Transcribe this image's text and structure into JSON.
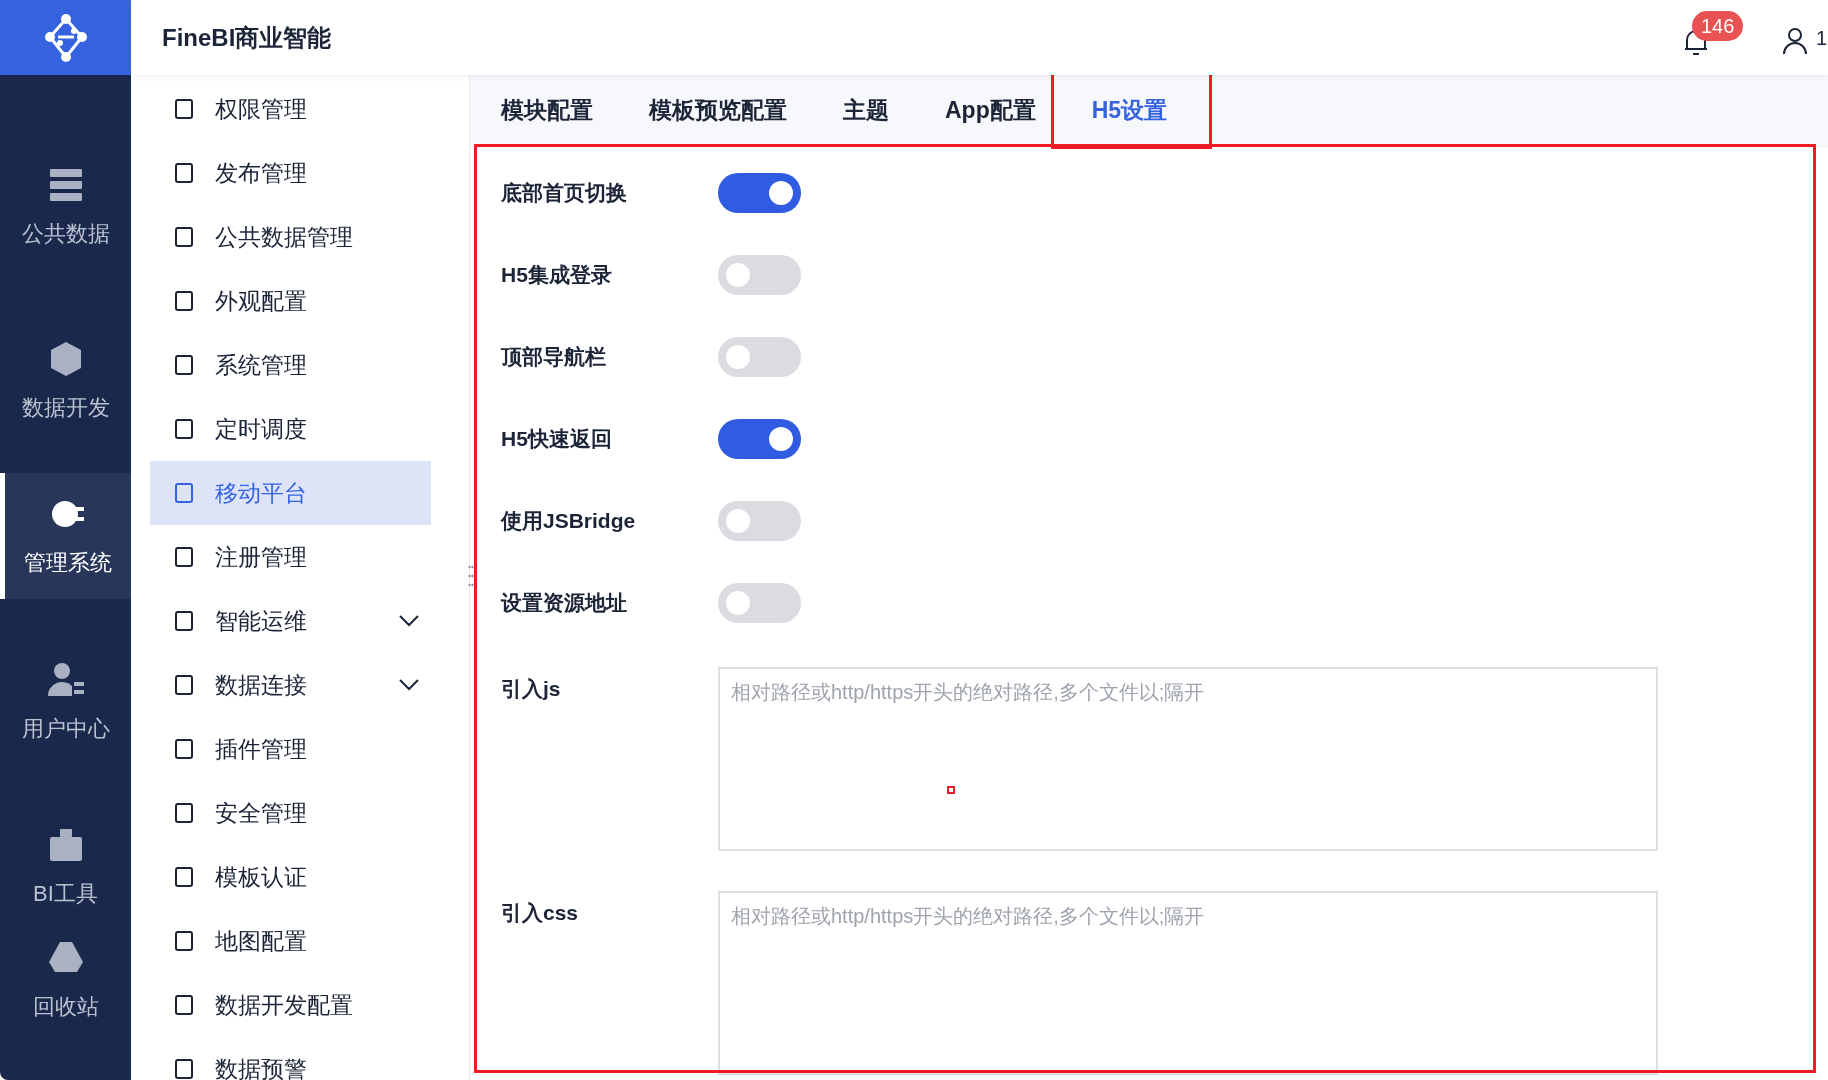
{
  "header": {
    "title": "FineBI商业智能",
    "notification_count": "146",
    "user_text": "1"
  },
  "nav": {
    "items": [
      {
        "label": "公共数据",
        "selected": false
      },
      {
        "label": "数据开发",
        "selected": false
      },
      {
        "label": "管理系统",
        "selected": true
      },
      {
        "label": "用户中心",
        "selected": false
      },
      {
        "label": "BI工具",
        "selected": false
      },
      {
        "label": "回收站",
        "selected": false
      }
    ]
  },
  "sidebar": {
    "items": [
      {
        "label": "权限管理",
        "selected": false,
        "kind": "link"
      },
      {
        "label": "发布管理",
        "selected": false,
        "kind": "link"
      },
      {
        "label": "公共数据管理",
        "selected": false,
        "kind": "link"
      },
      {
        "label": "外观配置",
        "selected": false,
        "kind": "link"
      },
      {
        "label": "系统管理",
        "selected": false,
        "kind": "link"
      },
      {
        "label": "定时调度",
        "selected": false,
        "kind": "link"
      },
      {
        "label": "移动平台",
        "selected": true,
        "kind": "link"
      },
      {
        "label": "注册管理",
        "selected": false,
        "kind": "link"
      },
      {
        "label": "智能运维",
        "selected": false,
        "kind": "group"
      },
      {
        "label": "数据连接",
        "selected": false,
        "kind": "group"
      },
      {
        "label": "插件管理",
        "selected": false,
        "kind": "link"
      },
      {
        "label": "安全管理",
        "selected": false,
        "kind": "link"
      },
      {
        "label": "模板认证",
        "selected": false,
        "kind": "link"
      },
      {
        "label": "地图配置",
        "selected": false,
        "kind": "link"
      },
      {
        "label": "数据开发配置",
        "selected": false,
        "kind": "link"
      },
      {
        "label": "数据预警",
        "selected": false,
        "kind": "link"
      }
    ]
  },
  "tabs": [
    {
      "label": "模块配置",
      "selected": false
    },
    {
      "label": "模板预览配置",
      "selected": false
    },
    {
      "label": "主题",
      "selected": false
    },
    {
      "label": "App配置",
      "selected": false
    },
    {
      "label": "H5设置",
      "selected": true
    }
  ],
  "settings": [
    {
      "label": "底部首页切换",
      "on": true
    },
    {
      "label": "H5集成登录",
      "on": false
    },
    {
      "label": "顶部导航栏",
      "on": false
    },
    {
      "label": "H5快速返回",
      "on": true
    },
    {
      "label": "使用JSBridge",
      "on": false
    },
    {
      "label": "设置资源地址",
      "on": false
    }
  ],
  "fields": [
    {
      "label": "引入js",
      "placeholder": "相对路径或http/https开头的绝对路径,多个文件以;隔开"
    },
    {
      "label": "引入css",
      "placeholder": "相对路径或http/https开头的绝对路径,多个文件以;隔开"
    }
  ]
}
